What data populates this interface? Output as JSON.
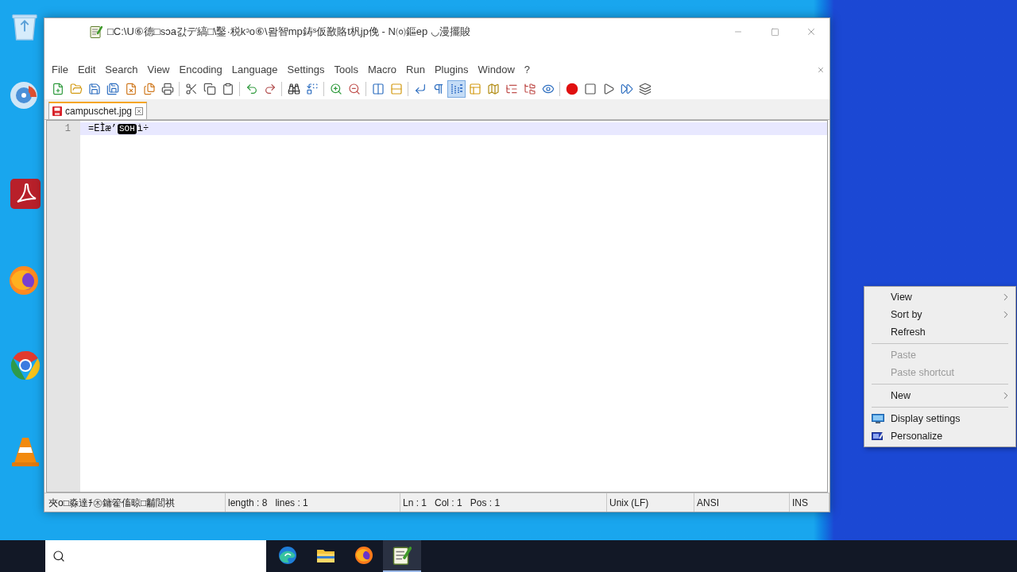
{
  "window": {
    "title": "□C:\\U⑥德□sↄa갌デ縞□\\鑿·税kᵓo⑥\\뫔智mp鋳ˢ仮敾賂t杋jp俛 - N㈇鏂ep ◡漫擺賐"
  },
  "menu": [
    "File",
    "Edit",
    "Search",
    "View",
    "Encoding",
    "Language",
    "Settings",
    "Tools",
    "Macro",
    "Run",
    "Plugins",
    "Window",
    "?"
  ],
  "toolbar": [
    [
      {
        "kind": "new",
        "selected": false
      },
      {
        "kind": "open",
        "selected": false
      },
      {
        "kind": "save",
        "selected": false
      },
      {
        "kind": "saveall",
        "selected": false
      },
      {
        "kind": "close",
        "selected": false
      },
      {
        "kind": "closeall",
        "selected": false
      },
      {
        "kind": "print",
        "selected": false
      }
    ],
    [
      {
        "kind": "cut",
        "selected": false
      },
      {
        "kind": "copy",
        "selected": false
      },
      {
        "kind": "paste",
        "selected": false
      }
    ],
    [
      {
        "kind": "undo",
        "selected": false
      },
      {
        "kind": "redo",
        "selected": false
      }
    ],
    [
      {
        "kind": "find",
        "selected": false
      },
      {
        "kind": "replace",
        "selected": false
      }
    ],
    [
      {
        "kind": "zoomin",
        "selected": false
      },
      {
        "kind": "zoomout",
        "selected": false
      }
    ],
    [
      {
        "kind": "syncv",
        "selected": false
      },
      {
        "kind": "synch",
        "selected": false
      }
    ],
    [
      {
        "kind": "wrap",
        "selected": false
      },
      {
        "kind": "allchars",
        "selected": false
      },
      {
        "kind": "indent",
        "selected": true
      },
      {
        "kind": "udl",
        "selected": false
      },
      {
        "kind": "docmap",
        "selected": false
      },
      {
        "kind": "funclist",
        "selected": false
      },
      {
        "kind": "workspace",
        "selected": false
      },
      {
        "kind": "monitor",
        "selected": false
      }
    ],
    [
      {
        "kind": "record",
        "selected": false
      },
      {
        "kind": "stop",
        "selected": false
      },
      {
        "kind": "play",
        "selected": false
      },
      {
        "kind": "playmulti",
        "selected": false
      },
      {
        "kind": "savemacro",
        "selected": false
      }
    ]
  ],
  "tabs": [
    {
      "label": "campuschet.jpg",
      "selected": true,
      "modified": true
    }
  ],
  "editor": {
    "lines": [
      {
        "number": "1",
        "current": true,
        "segments": [
          {
            "kind": "text",
            "text": "=EÌæ’"
          },
          {
            "kind": "control",
            "text": "SOH"
          },
          {
            "kind": "text",
            "text": "ì÷"
          }
        ]
      }
    ]
  },
  "status_bar": [
    [
      "夾o□淼達ﾁ㊍鏞篧傗晾□黼閭祺"
    ],
    [
      "length : 8",
      "lines : 1"
    ],
    [
      "Ln : 1",
      "Col : 1",
      "Pos : 1"
    ],
    [
      "Unix (LF)"
    ],
    [
      "ANSI"
    ],
    [
      "INS"
    ]
  ],
  "context_menu": [
    {
      "label": "View",
      "kind": "submenu",
      "disabled": false
    },
    {
      "label": "Sort by",
      "kind": "submenu",
      "disabled": false
    },
    {
      "label": "Refresh",
      "kind": "command",
      "disabled": false
    },
    {
      "kind": "separator"
    },
    {
      "label": "Paste",
      "kind": "command",
      "disabled": true
    },
    {
      "label": "Paste shortcut",
      "kind": "command",
      "disabled": true
    },
    {
      "kind": "separator"
    },
    {
      "label": "New",
      "kind": "submenu",
      "disabled": false
    },
    {
      "kind": "separator"
    },
    {
      "label": "Display settings",
      "kind": "display",
      "disabled": false
    },
    {
      "label": "Personalize",
      "kind": "personalize",
      "disabled": false
    }
  ],
  "taskbar": {
    "apps": [
      {
        "kind": "swirl",
        "selected": false
      },
      {
        "kind": "folder",
        "selected": false
      },
      {
        "kind": "fox",
        "selected": false
      },
      {
        "kind": "notepad",
        "selected": true
      }
    ]
  }
}
